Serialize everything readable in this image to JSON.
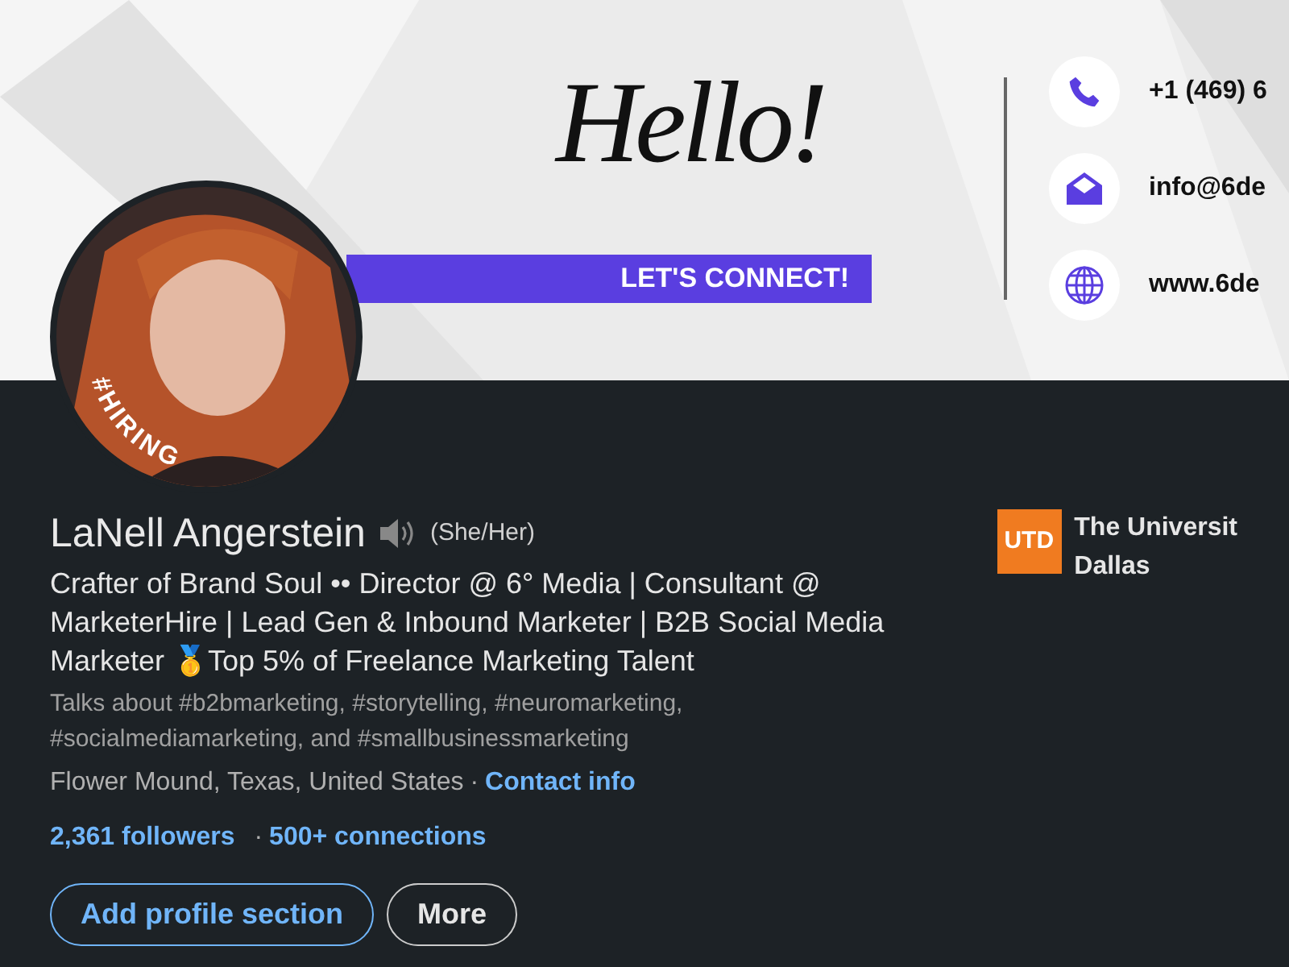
{
  "banner": {
    "greeting": "Hello!",
    "tagline": "LET'S CONNECT!",
    "contacts": [
      {
        "kind": "phone",
        "text": "+1 (469) 6"
      },
      {
        "kind": "email",
        "text": "info@6de"
      },
      {
        "kind": "web",
        "text": "www.6de"
      }
    ]
  },
  "avatar": {
    "kind": "picture",
    "frame_label": "#HIRING"
  },
  "profile": {
    "name": "LaNell Angerstein",
    "pronouns": "(She/Her)",
    "headline": "Crafter of Brand Soul •• Director @ 6° Media | Consultant @ MarketerHire | Lead Gen & Inbound Marketer | B2B Social Media Marketer 🥇Top 5% of Freelance Marketing Talent",
    "talks_about": "Talks about #b2bmarketing, #storytelling, #neuromarketing, #socialmediamarketing, and #smallbusinessmarketing",
    "location": "Flower Mound, Texas, United States",
    "location_separator": "·",
    "stats_separator": "·",
    "contact_link": "Contact info",
    "followers": "2,361 followers",
    "connections": "500+ connections"
  },
  "education": {
    "logo": "UTD",
    "lines": [
      "The Universit",
      "Dallas"
    ]
  },
  "buttons": [
    {
      "kind": "outline-primary",
      "label": "Add profile section"
    },
    {
      "kind": "outline-secondary",
      "label": "More"
    }
  ]
}
